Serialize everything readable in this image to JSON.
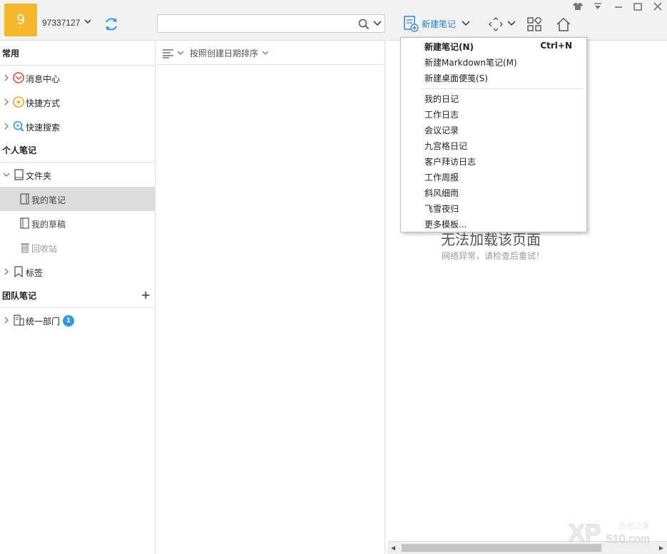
{
  "topbar": {
    "avatar_text": "9",
    "user_id": "97337127",
    "search_placeholder": "",
    "new_note_label": "新建笔记"
  },
  "sidebar": {
    "section_common": "常用",
    "common_items": [
      {
        "label": "消息中心"
      },
      {
        "label": "快捷方式"
      },
      {
        "label": "快速搜索"
      }
    ],
    "section_personal": "个人笔记",
    "folder_label": "文件夹",
    "folder_children": [
      {
        "label": "我的笔记"
      },
      {
        "label": "我的草稿"
      },
      {
        "label": "回收站"
      }
    ],
    "tags_label": "标签",
    "section_team": "团队笔记",
    "team_item": "统一部门",
    "team_badge": "1"
  },
  "list": {
    "sort_label": "按照创建日期排序"
  },
  "content": {
    "error_title": "无法加载该页面",
    "error_sub": "网络异常，请检查后重试！"
  },
  "dropdown": {
    "new_note": "新建笔记(N)",
    "new_note_shortcut": "Ctrl+N",
    "new_markdown": "新建Markdown笔记(M)",
    "new_sticky": "新建桌面便笺(S)",
    "templates": [
      "我的日记",
      "工作日志",
      "会议记录",
      "九宫格日记",
      "客户拜访日志",
      "工作周报",
      "斜风细雨",
      "飞雪夜归",
      "更多模板..."
    ]
  },
  "watermark_text": "XP 510.com 系统之家",
  "colors": {
    "accent": "#2c7fc9",
    "avatar_bg": "#f5b72a",
    "badge_bg": "#2d9ae8",
    "active_row": "#dcdcdc"
  }
}
